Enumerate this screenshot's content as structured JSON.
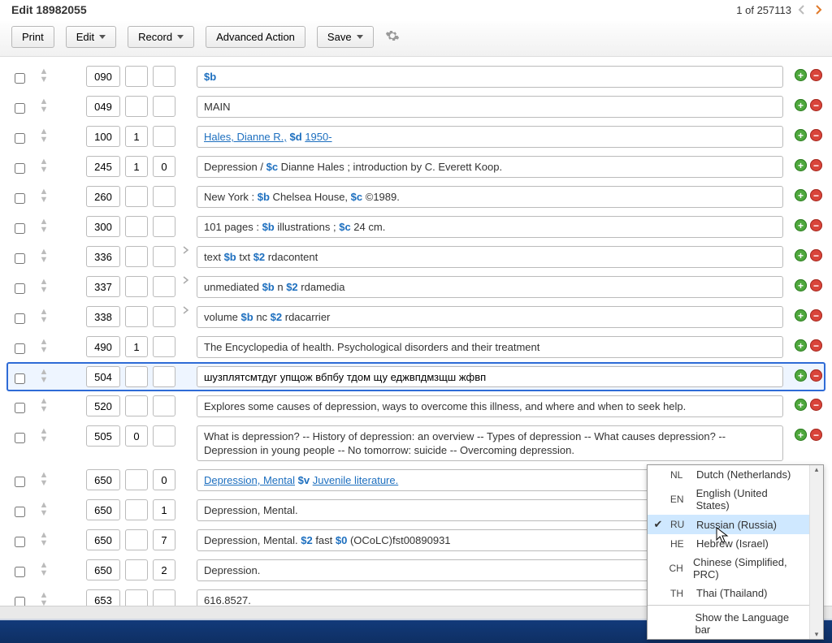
{
  "header": {
    "title": "Edit 18982055",
    "record_counter": "1 of 257113"
  },
  "toolbar": {
    "print": "Print",
    "edit": "Edit",
    "record": "Record",
    "advanced": "Advanced Action",
    "save": "Save"
  },
  "rows": [
    {
      "tag": "090",
      "i1": "",
      "i2": "",
      "exp": false,
      "value_html": "<span class='subf'>$b</span>",
      "plain": "$b"
    },
    {
      "tag": "049",
      "i1": "",
      "i2": "",
      "exp": false,
      "value_html": "MAIN",
      "plain": "MAIN"
    },
    {
      "tag": "100",
      "i1": "1",
      "i2": "",
      "exp": false,
      "value_html": "<span class='lnk'>Hales, Dianne R.,</span> <span class='subf'>$d</span>  <span class='lnk'>1950-</span>",
      "plain": "Hales, Dianne R., $d 1950-"
    },
    {
      "tag": "245",
      "i1": "1",
      "i2": "0",
      "exp": false,
      "value_html": "Depression / <span class='subf'>$c</span> Dianne Hales ; introduction by C. Everett Koop.",
      "plain": "Depression / $c Dianne Hales ; introduction by C. Everett Koop."
    },
    {
      "tag": "260",
      "i1": "",
      "i2": "",
      "exp": false,
      "value_html": "New York : <span class='subf'>$b</span> Chelsea House, <span class='subf'>$c</span> ©1989.",
      "plain": "New York : $b Chelsea House, $c ©1989."
    },
    {
      "tag": "300",
      "i1": "",
      "i2": "",
      "exp": false,
      "value_html": "101 pages : <span class='subf'>$b</span> illustrations ; <span class='subf'>$c</span> 24 cm.",
      "plain": "101 pages : $b illustrations ; $c 24 cm."
    },
    {
      "tag": "336",
      "i1": "",
      "i2": "",
      "exp": true,
      "value_html": "text <span class='subf'>$b</span> txt <span class='subf'>$2</span> rdacontent",
      "plain": "text $b txt $2 rdacontent"
    },
    {
      "tag": "337",
      "i1": "",
      "i2": "",
      "exp": true,
      "value_html": "unmediated <span class='subf'>$b</span> n <span class='subf'>$2</span> rdamedia",
      "plain": "unmediated $b n $2 rdamedia"
    },
    {
      "tag": "338",
      "i1": "",
      "i2": "",
      "exp": true,
      "value_html": "volume <span class='subf'>$b</span> nc <span class='subf'>$2</span> rdacarrier",
      "plain": "volume $b nc $2 rdacarrier"
    },
    {
      "tag": "490",
      "i1": "1",
      "i2": "",
      "exp": false,
      "value_html": "The Encyclopedia of health. Psychological disorders and their treatment",
      "plain": "The Encyclopedia of health. Psychological disorders and their treatment"
    },
    {
      "tag": "504",
      "i1": "",
      "i2": "",
      "exp": false,
      "selected": true,
      "editable": true,
      "value_html": "шузплятсмтдуг упщож вбпбу тдом щу еджвпдмзщш жфвп",
      "plain": "шузплятсмтдуг упщож вбпбу тдом щу еджвпдмзщш жфвп"
    },
    {
      "tag": "520",
      "i1": "",
      "i2": "",
      "exp": false,
      "value_html": "Explores some causes of depression, ways to overcome this illness, and where and when to seek help.",
      "plain": "Explores some causes of depression, ways to overcome this illness, and where and when to seek help."
    },
    {
      "tag": "505",
      "i1": "0",
      "i2": "",
      "exp": false,
      "value_html": "What is depression? -- History of depression: an overview -- Types of depression -- What causes depression? -- Depression in young people -- No tomorrow: suicide -- Overcoming depression.",
      "plain": "What is depression? -- History of depression: an overview -- Types of depression -- What causes depression? -- Depression in young people -- No tomorrow: suicide -- Overcoming depression."
    },
    {
      "tag": "650",
      "i1": "",
      "i2": "0",
      "exp": false,
      "value_html": "<span class='lnk'>Depression, Mental</span> <span class='subf'>$v</span>  <span class='lnk'>Juvenile literature.</span>",
      "plain": "Depression, Mental $v Juvenile literature."
    },
    {
      "tag": "650",
      "i1": "",
      "i2": "1",
      "exp": false,
      "value_html": "Depression, Mental.",
      "plain": "Depression, Mental."
    },
    {
      "tag": "650",
      "i1": "",
      "i2": "7",
      "exp": false,
      "value_html": "Depression, Mental. <span class='subf'>$2</span> fast <span class='subf'>$0</span> (OCoLC)fst00890931",
      "plain": "Depression, Mental. $2 fast $0 (OCoLC)fst00890931"
    },
    {
      "tag": "650",
      "i1": "",
      "i2": "2",
      "exp": false,
      "value_html": "Depression.",
      "plain": "Depression."
    },
    {
      "tag": "653",
      "i1": "",
      "i2": "",
      "exp": false,
      "value_html": "616.8527.",
      "plain": "616.8527."
    }
  ],
  "lang_menu": {
    "items": [
      {
        "code": "NL",
        "label": "Dutch (Netherlands)"
      },
      {
        "code": "EN",
        "label": "English (United States)"
      },
      {
        "code": "RU",
        "label": "Russian (Russia)",
        "selected": true
      },
      {
        "code": "HE",
        "label": "Hebrew (Israel)"
      },
      {
        "code": "CH",
        "label": "Chinese (Simplified, PRC)"
      },
      {
        "code": "TH",
        "label": "Thai (Thailand)"
      }
    ],
    "footer": "Show the Language bar"
  }
}
